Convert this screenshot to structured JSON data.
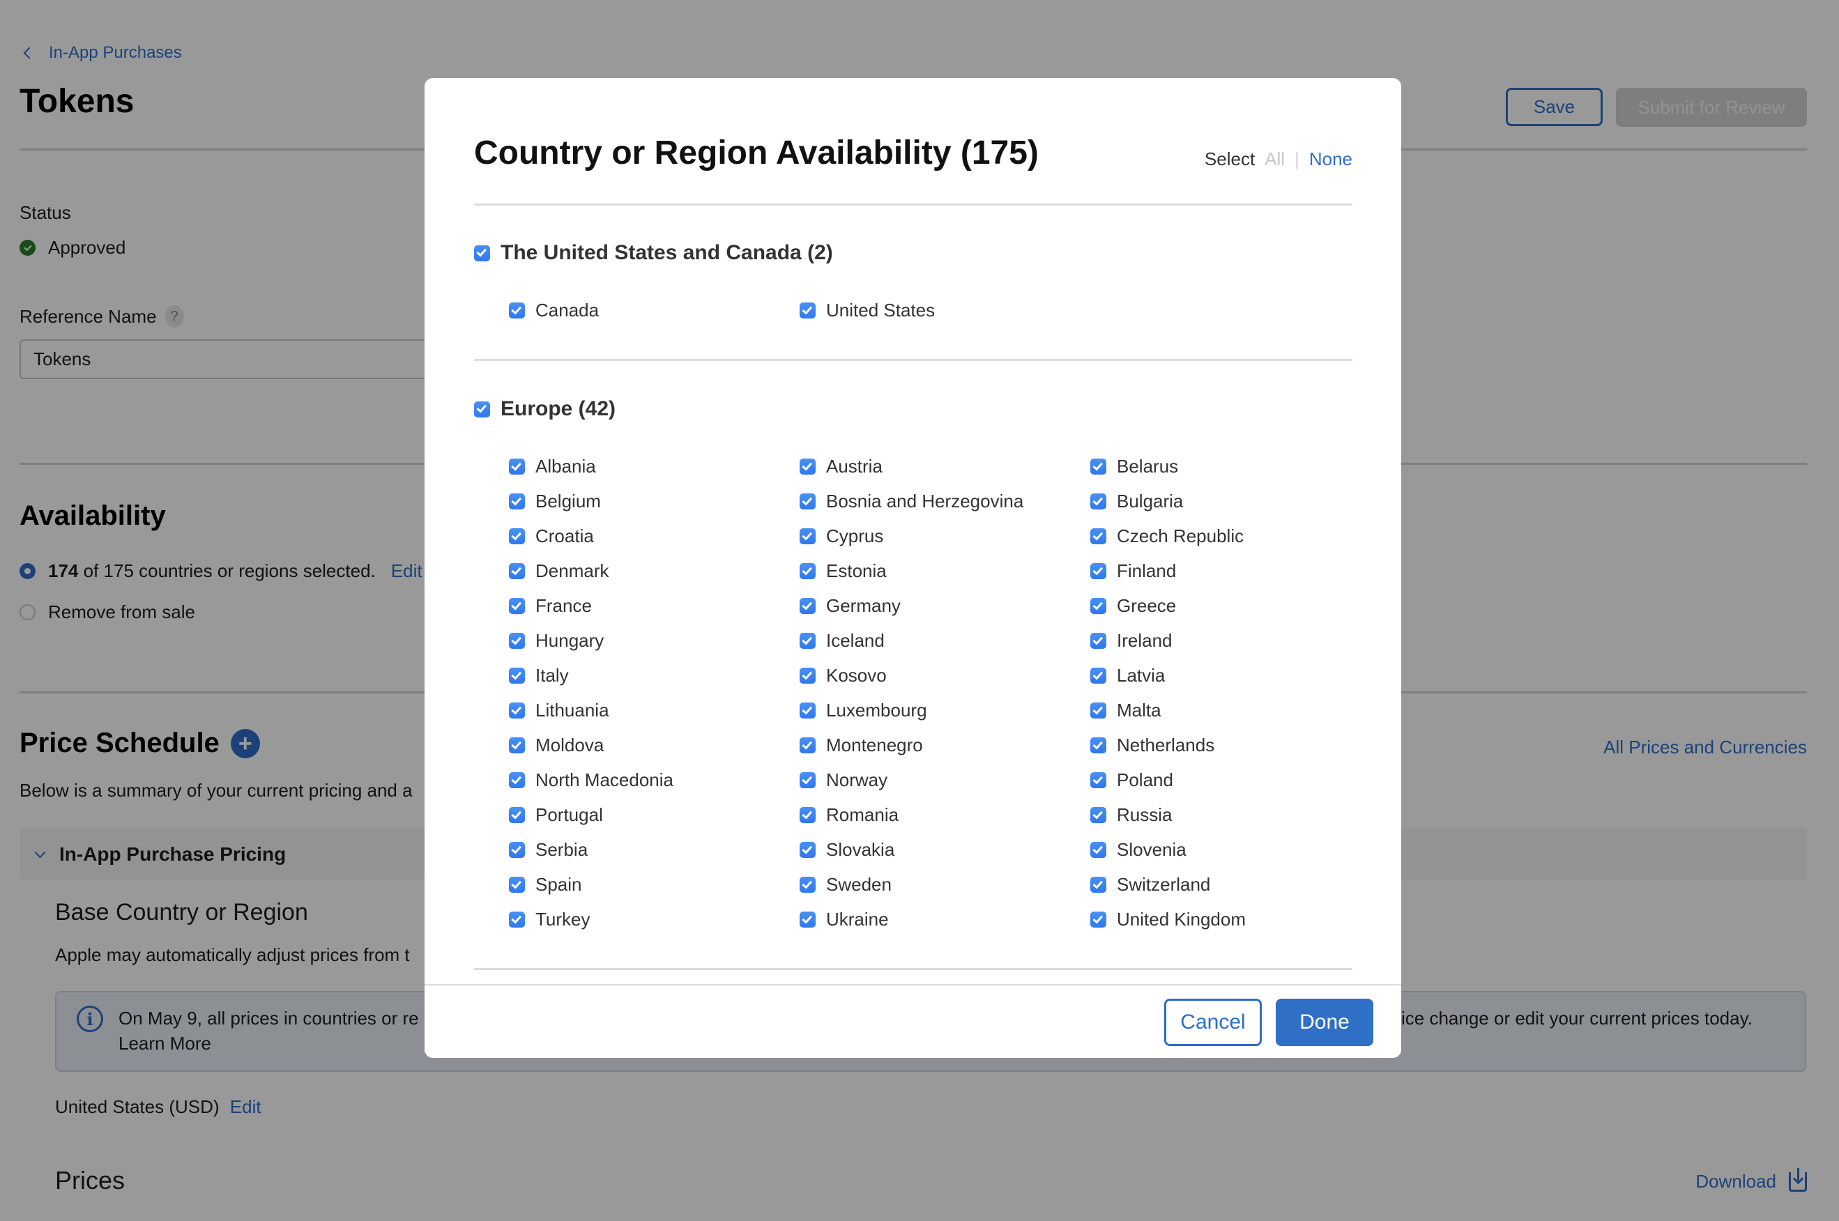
{
  "header": {
    "breadcrumb": "In-App Purchases",
    "title": "Tokens",
    "save_label": "Save",
    "submit_label": "Submit for Review"
  },
  "status": {
    "label": "Status",
    "value": "Approved",
    "color": "#2c7a2c"
  },
  "reference_name": {
    "label": "Reference Name",
    "help": "?",
    "value": "Tokens"
  },
  "availability": {
    "title": "Availability",
    "selected_count": "174",
    "selected_rest": "of 175 countries or regions selected.",
    "edit_label": "Edit",
    "remove_label": "Remove from sale"
  },
  "price_schedule": {
    "title": "Price Schedule",
    "description": "Below is a summary of your current pricing and a",
    "all_prices_link": "All Prices and Currencies",
    "section_label": "In-App Purchase Pricing",
    "base_title": "Base Country or Region",
    "base_description": "Apple may automatically adjust prices from t",
    "info_text_left": "On May 9, all prices in countries or re",
    "info_text_right": "ice change or edit your current prices today.",
    "learn_more": "Learn More",
    "base_value": "United States (USD)",
    "base_edit": "Edit",
    "prices_title": "Prices",
    "download_label": "Download"
  },
  "modal": {
    "title": "Country or Region Availability (175)",
    "select_label": "Select",
    "select_all": "All",
    "select_sep": "|",
    "select_none": "None",
    "groups": [
      {
        "label": "The United States and Canada (2)",
        "checked": true,
        "items": [
          "Canada",
          "United States"
        ]
      },
      {
        "label": "Europe (42)",
        "checked": true,
        "items": [
          "Albania",
          "Austria",
          "Belarus",
          "Belgium",
          "Bosnia and Herzegovina",
          "Bulgaria",
          "Croatia",
          "Cyprus",
          "Czech Republic",
          "Denmark",
          "Estonia",
          "Finland",
          "France",
          "Germany",
          "Greece",
          "Hungary",
          "Iceland",
          "Ireland",
          "Italy",
          "Kosovo",
          "Latvia",
          "Lithuania",
          "Luxembourg",
          "Malta",
          "Moldova",
          "Montenegro",
          "Netherlands",
          "North Macedonia",
          "Norway",
          "Poland",
          "Portugal",
          "Romania",
          "Russia",
          "Serbia",
          "Slovakia",
          "Slovenia",
          "Spain",
          "Sweden",
          "Switzerland",
          "Turkey",
          "Ukraine",
          "United Kingdom"
        ]
      }
    ],
    "cancel_label": "Cancel",
    "done_label": "Done"
  },
  "colors": {
    "accent": "#2d6ec9",
    "checkbox": "#3b82f6",
    "overlay": "#999999"
  }
}
